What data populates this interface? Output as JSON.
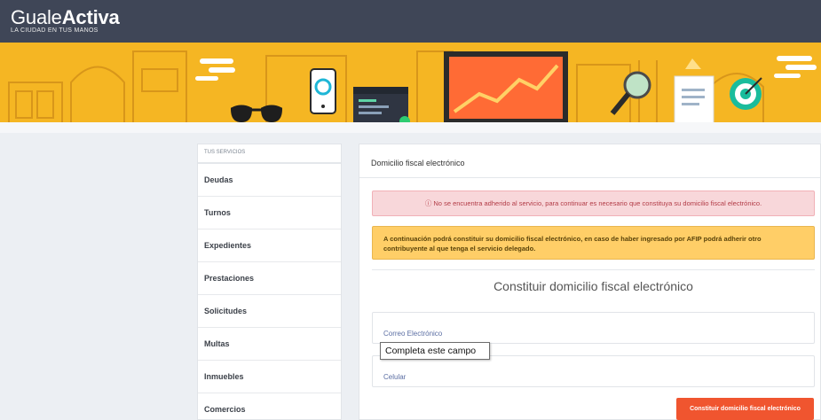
{
  "header": {
    "logo_light": "Guale",
    "logo_bold": "Activa",
    "logo_tagline": "LA CIUDAD EN TUS MANOS"
  },
  "sidebar": {
    "title": "TUS SERVICIOS",
    "items": [
      {
        "label": "Deudas"
      },
      {
        "label": "Turnos"
      },
      {
        "label": "Expedientes"
      },
      {
        "label": "Prestaciones"
      },
      {
        "label": "Solicitudes"
      },
      {
        "label": "Multas"
      },
      {
        "label": "Inmuebles"
      },
      {
        "label": "Comercios"
      }
    ]
  },
  "panel": {
    "title": "Domicilio fiscal electrónico",
    "alert_danger": "ⓘ No se encuentra adherido al servicio, para continuar es necesario que constituya su domicilio fiscal electrónico.",
    "alert_warning": "A continuación podrá constituir su domicilio fiscal electrónico, en caso de haber ingresado por AFIP podrá adherir otro contribuyente al que tenga el servicio delegado.",
    "form_heading": "Constituir domicilio fiscal electrónico",
    "email_placeholder": "Correo Electrónico",
    "phone_placeholder": "Celular",
    "validation_tooltip": "Completa este campo",
    "submit_label": "Constituir domicilio fiscal electrónico"
  },
  "colors": {
    "header_bg": "#3f4657",
    "banner_bg": "#f5b623",
    "danger_bg": "#f8d7da",
    "warning_bg": "#ffce67",
    "submit_bg": "#f0552f"
  }
}
